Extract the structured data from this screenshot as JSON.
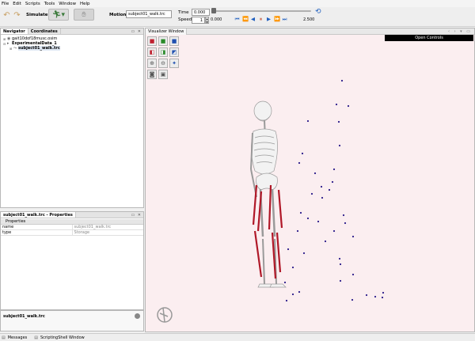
{
  "menu": [
    "File",
    "Edit",
    "Scripts",
    "Tools",
    "Window",
    "Help"
  ],
  "toolbar": {
    "simulate_label": "Simulate",
    "motion_label": "Motion:",
    "motion_value": "subject01_walk.trc",
    "time_label": "Time",
    "time_value": "0.000",
    "speed_label": "Speed",
    "speed_value": "1",
    "time_start": "0.000",
    "time_end": "2.500",
    "progress": 0.0
  },
  "navigator": {
    "tabs": [
      "Navigator",
      "Coordinates"
    ],
    "items": [
      {
        "label": "gait10dof18musc.osim"
      },
      {
        "label": "ExperimentalData_1"
      },
      {
        "label": "subject01_walk.trc"
      }
    ]
  },
  "properties": {
    "title": "subject01_walk.trc - Properties",
    "header": "Properties",
    "rows": [
      {
        "name": "name",
        "value": "subject01_walk.trc"
      },
      {
        "name": "type",
        "value": "Storage"
      }
    ]
  },
  "status": {
    "text": "subject01_walk.trc"
  },
  "bottom_tabs": [
    "Messages",
    "ScriptingShell Window"
  ],
  "visualizer": {
    "tab": "Visualizer Window",
    "open_controls": "Open Controls",
    "background_color": "#fbeef0",
    "marker_color": "#2a1a8a",
    "muscle_color": "#b01828"
  },
  "icons": {
    "undo": "undo-icon",
    "redo": "redo-icon",
    "simulate": "run-icon",
    "stop": "stop-hand-icon",
    "loop": "loop-icon",
    "opensim_logo": "opensim-logo"
  }
}
